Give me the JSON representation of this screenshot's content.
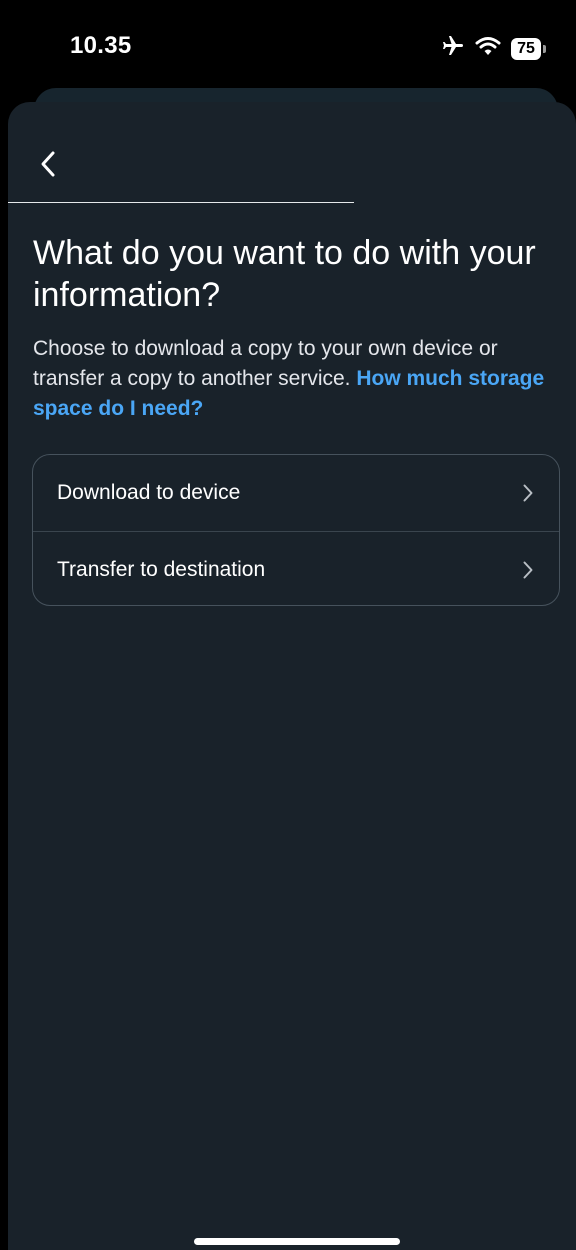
{
  "status_bar": {
    "time": "10.35",
    "battery_level": "75",
    "icons": [
      "airplane-icon",
      "wifi-icon",
      "battery-icon"
    ]
  },
  "header": {
    "back_icon": "chevron-left-icon"
  },
  "content": {
    "title": "What do you want to do with your information?",
    "description": "Choose to download a copy to your own device or transfer a copy to another service. ",
    "help_link": "How much storage space do I need?"
  },
  "options": [
    {
      "label": "Download to device",
      "icon": "chevron-right-icon"
    },
    {
      "label": "Transfer to destination",
      "icon": "chevron-right-icon"
    }
  ],
  "colors": {
    "background": "#19222a",
    "link": "#4aa6f5",
    "text": "#ffffff"
  }
}
